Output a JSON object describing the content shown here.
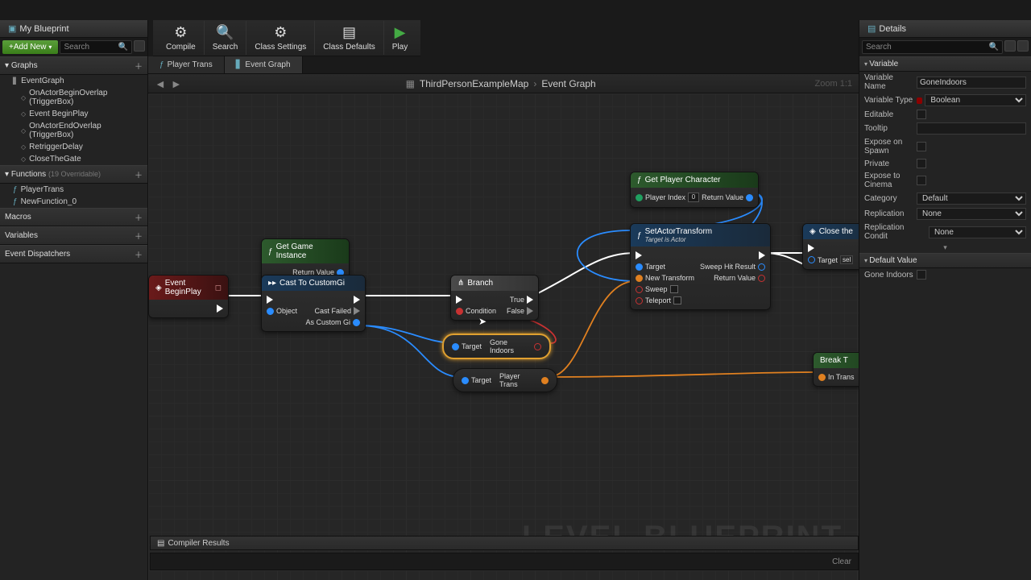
{
  "toolbar": {
    "compile": "Compile",
    "search": "Search",
    "classSettings": "Class Settings",
    "classDefaults": "Class Defaults",
    "play": "Play"
  },
  "leftPanel": {
    "title": "My Blueprint",
    "addNew": "Add New",
    "searchPlaceholder": "Search",
    "categories": {
      "graphs": "Graphs",
      "functions": "Functions",
      "functionsHint": "(19 Overridable)",
      "macros": "Macros",
      "variables": "Variables",
      "eventDispatchers": "Event Dispatchers"
    },
    "graphItems": {
      "eventGraph": "EventGraph",
      "onBeginOverlap": "OnActorBeginOverlap (TriggerBox)",
      "eventBeginPlay": "Event BeginPlay",
      "onEndOverlap": "OnActorEndOverlap (TriggerBox)",
      "retriggerDelay": "RetriggerDelay",
      "closeTheGate": "CloseTheGate"
    },
    "functionItems": {
      "playerTrans": "PlayerTrans",
      "newFunction": "NewFunction_0"
    }
  },
  "rightPanel": {
    "title": "Details",
    "searchPlaceholder": "Search",
    "sections": {
      "variable": "Variable",
      "defaultValue": "Default Value"
    },
    "props": {
      "varName": {
        "label": "Variable Name",
        "value": "GoneIndoors"
      },
      "varType": {
        "label": "Variable Type",
        "value": "Boolean"
      },
      "editable": {
        "label": "Editable"
      },
      "tooltip": {
        "label": "Tooltip",
        "value": ""
      },
      "exposeSpawn": {
        "label": "Expose on Spawn"
      },
      "private": {
        "label": "Private"
      },
      "exposeCinema": {
        "label": "Expose to Cinema"
      },
      "category": {
        "label": "Category",
        "value": "Default"
      },
      "replication": {
        "label": "Replication",
        "value": "None"
      },
      "replicationCond": {
        "label": "Replication Condit",
        "value": "None"
      },
      "goneIndoors": {
        "label": "Gone Indoors"
      }
    }
  },
  "graphTabs": {
    "playerTrans": "Player Trans",
    "eventGraph": "Event Graph"
  },
  "breadcrumb": {
    "map": "ThirdPersonExampleMap",
    "graph": "Event Graph",
    "zoom": "Zoom 1:1"
  },
  "nodes": {
    "getGameInstance": {
      "title": "Get Game Instance",
      "returnValue": "Return Value"
    },
    "eventBeginPlay": {
      "title": "Event BeginPlay"
    },
    "castTo": {
      "title": "Cast To CustomGi",
      "object": "Object",
      "castFailed": "Cast Failed",
      "asCustom": "As Custom Gi"
    },
    "branch": {
      "title": "Branch",
      "condition": "Condition",
      "true": "True",
      "false": "False"
    },
    "goneIndoorsPill": {
      "target": "Target",
      "value": "Gone Indoors"
    },
    "playerTransPill": {
      "target": "Target",
      "value": "Player Trans"
    },
    "getPlayerChar": {
      "title": "Get Player Character",
      "playerIndex": "Player Index",
      "indexVal": "0",
      "returnValue": "Return Value"
    },
    "setActorTransform": {
      "title": "SetActorTransform",
      "subtitle": "Target is Actor",
      "target": "Target",
      "newTransform": "New Transform",
      "sweep": "Sweep",
      "teleport": "Teleport",
      "sweepHit": "Sweep Hit Result",
      "returnValue": "Return Value"
    },
    "closeGate": {
      "title": "Close the",
      "target": "Target",
      "self": "sel"
    },
    "breakT": {
      "title": "Break T",
      "inTrans": "In Trans"
    }
  },
  "watermark": "LEVEL BLUEPRINT",
  "bottom": {
    "compiler": "Compiler Results",
    "clear": "Clear"
  }
}
